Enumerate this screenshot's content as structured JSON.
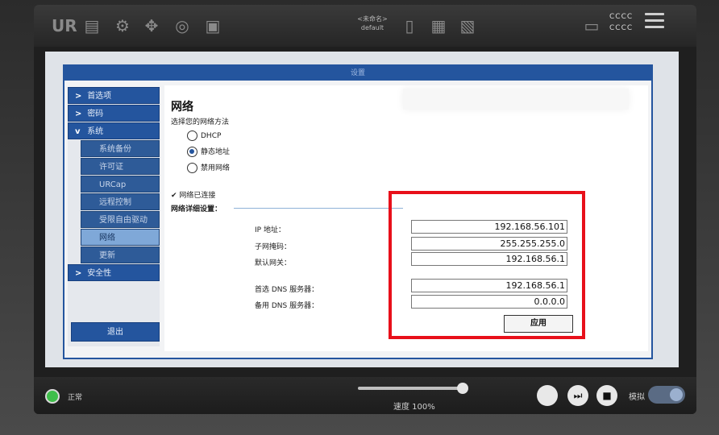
{
  "topbar": {
    "program_label": "<未命名>",
    "installation_name": "default",
    "status_lines": [
      "CCCC",
      "CCCC"
    ]
  },
  "window": {
    "title": "设置"
  },
  "sidebar": {
    "items": [
      {
        "label": "首选项",
        "chev": ">"
      },
      {
        "label": "密码",
        "chev": ">"
      },
      {
        "label": "系统",
        "chev": "v"
      }
    ],
    "sub_items": [
      "系统备份",
      "许可证",
      "URCap",
      "远程控制",
      "受限自由驱动",
      "网络",
      "更新"
    ],
    "active_sub": "网络",
    "safety": {
      "label": "安全性",
      "chev": ">"
    },
    "logout_label": "退出"
  },
  "network": {
    "title": "网络",
    "method_label": "选择您的网络方法",
    "options": [
      "DHCP",
      "静态地址",
      "禁用网络"
    ],
    "selected_option": "静态地址",
    "connected_text": "网络已连接",
    "details_label": "网络详细设置：",
    "fields": [
      {
        "label": "IP 地址：",
        "value": "192.168.56.101"
      },
      {
        "label": "子网掩码：",
        "value": "255.255.255.0"
      },
      {
        "label": "默认网关：",
        "value": "192.168.56.1"
      },
      {
        "label": "首选 DNS 服务器：",
        "value": "192.168.56.1"
      },
      {
        "label": "备用 DNS 服务器：",
        "value": "0.0.0.0"
      }
    ],
    "apply_label": "应用"
  },
  "bottombar": {
    "status": "正常",
    "speed": "速度 100%",
    "speed_fraction": 1.0,
    "sim_label": "模拟"
  },
  "colors": {
    "accent": "#24559e",
    "highlight": "#e8101a",
    "status_ok": "#3fbe4b"
  }
}
